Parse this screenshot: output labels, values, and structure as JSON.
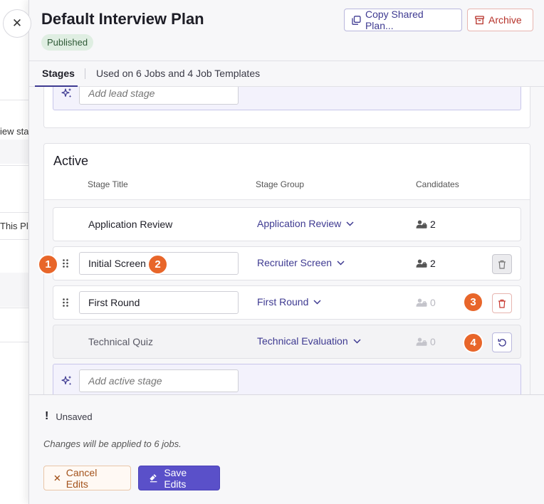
{
  "background": {
    "close_glyph": "✕",
    "fragment_1": "iew sta",
    "fragment_2": "This Pl"
  },
  "header": {
    "title": "Default Interview Plan",
    "status_badge": "Published",
    "copy_button": "Copy Shared Plan...",
    "archive_button": "Archive"
  },
  "tabs": {
    "active_tab": "Stages",
    "usage_info": "Used on 6 Jobs and 4 Job Templates"
  },
  "lead": {
    "add_placeholder": "Add lead stage"
  },
  "active": {
    "section_title": "Active",
    "columns": [
      "Stage Title",
      "Stage Group",
      "Candidates"
    ],
    "rows": [
      {
        "title": "Application Review",
        "group": "Application Review",
        "candidates": "2",
        "editable": false,
        "action": "none"
      },
      {
        "title": "Initial Screen",
        "group": "Recruiter Screen",
        "candidates": "2",
        "editable": true,
        "action": "delete-disabled"
      },
      {
        "title": "First Round",
        "group": "First Round",
        "candidates": "0",
        "editable": true,
        "action": "delete"
      },
      {
        "title": "Technical Quiz",
        "group": "Technical Evaluation",
        "candidates": "0",
        "editable": false,
        "action": "undo"
      }
    ],
    "add_placeholder": "Add active stage"
  },
  "footer": {
    "status": "Unsaved",
    "note": "Changes will be applied to 6 jobs.",
    "cancel_button": "Cancel Edits",
    "save_button": "Save Edits"
  },
  "markers": [
    "1",
    "2",
    "3",
    "4"
  ],
  "colors": {
    "accent": "#3e3a91",
    "primary_button": "#5a50c9",
    "danger": "#b6322a",
    "marker": "#e8662a",
    "published_badge": "#dfeee2"
  },
  "icons": {
    "close": "close-icon",
    "copy": "copy-icon",
    "archive": "archive-icon",
    "sparkle": "sparkle-icon",
    "drag": "drag-handle-icon",
    "chevron": "chevron-down-icon",
    "candidates": "person-icon",
    "trash": "trash-icon",
    "undo": "undo-icon",
    "save": "save-icon"
  }
}
